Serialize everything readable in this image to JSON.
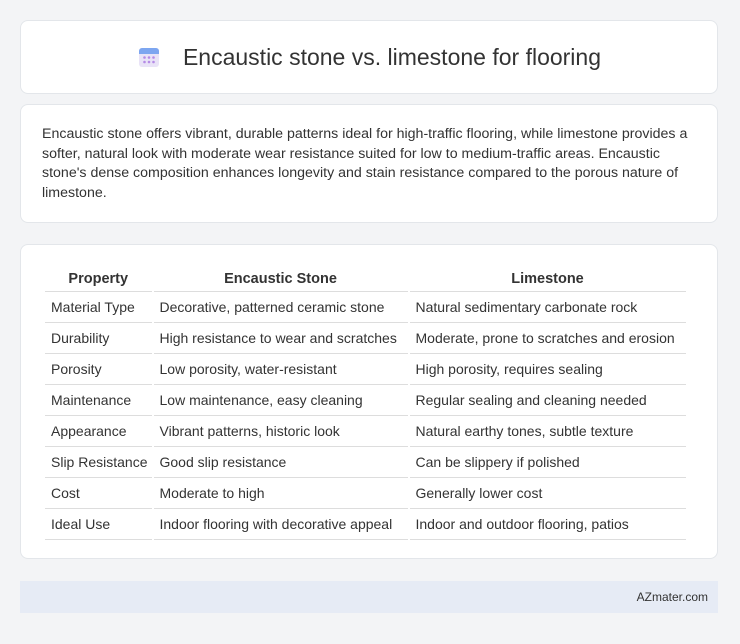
{
  "header": {
    "title": "Encaustic stone vs. limestone for flooring",
    "icon": "calendar-icon"
  },
  "summary": "Encaustic stone offers vibrant, durable patterns ideal for high-traffic flooring, while limestone provides a softer, natural look with moderate wear resistance suited for low to medium-traffic areas. Encaustic stone's dense composition enhances longevity and stain resistance compared to the porous nature of limestone.",
  "table": {
    "headers": [
      "Property",
      "Encaustic Stone",
      "Limestone"
    ],
    "rows": [
      [
        "Material Type",
        "Decorative, patterned ceramic stone",
        "Natural sedimentary carbonate rock"
      ],
      [
        "Durability",
        "High resistance to wear and scratches",
        "Moderate, prone to scratches and erosion"
      ],
      [
        "Porosity",
        "Low porosity, water-resistant",
        "High porosity, requires sealing"
      ],
      [
        "Maintenance",
        "Low maintenance, easy cleaning",
        "Regular sealing and cleaning needed"
      ],
      [
        "Appearance",
        "Vibrant patterns, historic look",
        "Natural earthy tones, subtle texture"
      ],
      [
        "Slip Resistance",
        "Good slip resistance",
        "Can be slippery if polished"
      ],
      [
        "Cost",
        "Moderate to high",
        "Generally lower cost"
      ],
      [
        "Ideal Use",
        "Indoor flooring with decorative appeal",
        "Indoor and outdoor flooring, patios"
      ]
    ]
  },
  "footer": {
    "brand": "AZmater.com"
  }
}
